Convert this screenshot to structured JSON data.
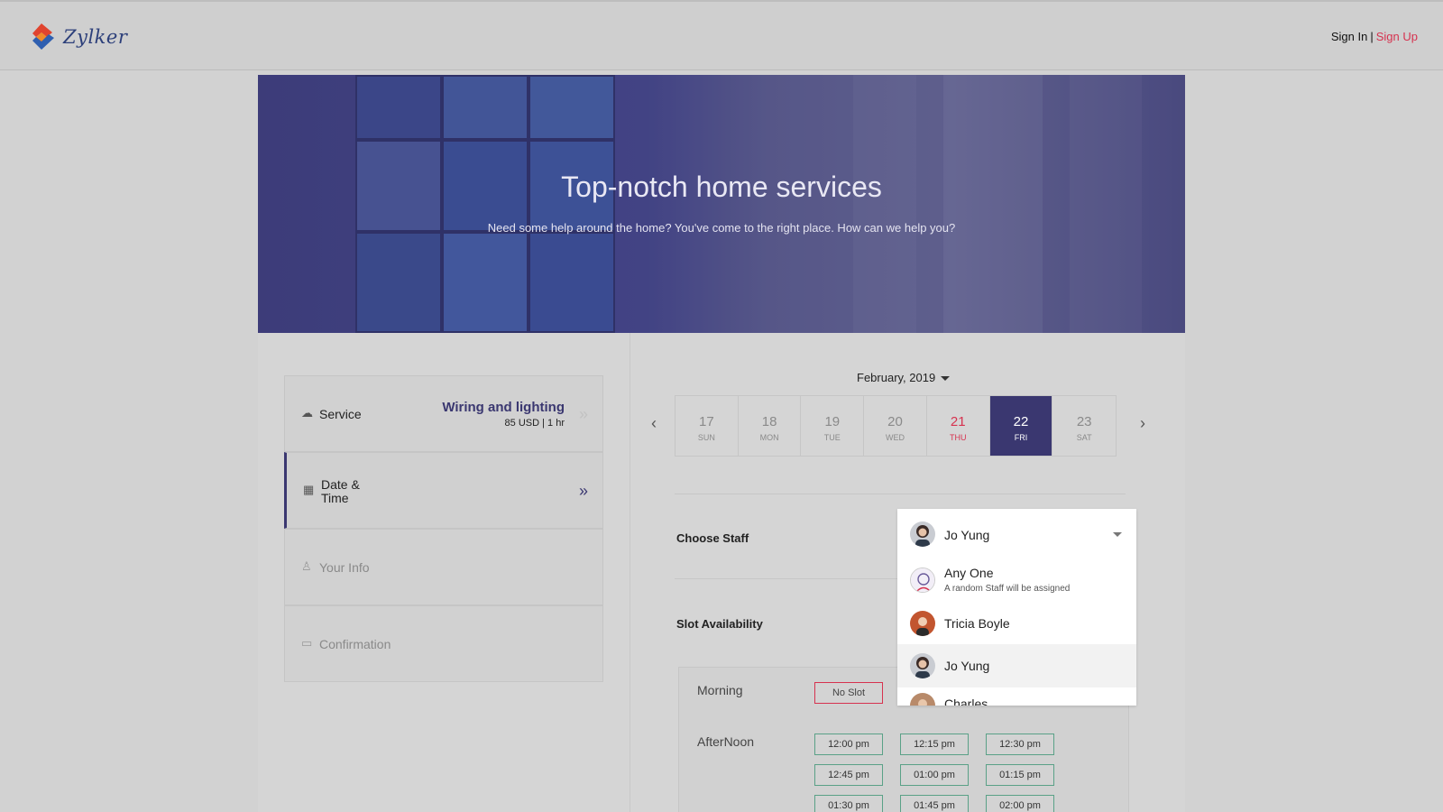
{
  "brand": {
    "name": "Zylker"
  },
  "auth": {
    "sign_in": "Sign In",
    "separator": "|",
    "sign_up": "Sign Up"
  },
  "hero": {
    "title": "Top-notch home services",
    "subtitle": "Need some help around the home? You've come to the right place. How can we help you?"
  },
  "steps": {
    "service": {
      "label": "Service",
      "name": "Wiring and lighting",
      "meta": "85 USD | 1 hr",
      "icon": "cloud-icon"
    },
    "datetime": {
      "label_line1": "Date &",
      "label_line2": "Time",
      "icon": "calendar-icon"
    },
    "info": {
      "label": "Your Info",
      "icon": "user-icon"
    },
    "confirmation": {
      "label": "Confirmation",
      "icon": "card-icon"
    }
  },
  "calendar": {
    "month": "February, 2019",
    "days": [
      {
        "num": "17",
        "dow": "SUN",
        "state": "normal"
      },
      {
        "num": "18",
        "dow": "MON",
        "state": "normal"
      },
      {
        "num": "19",
        "dow": "TUE",
        "state": "normal"
      },
      {
        "num": "20",
        "dow": "WED",
        "state": "normal"
      },
      {
        "num": "21",
        "dow": "THU",
        "state": "today"
      },
      {
        "num": "22",
        "dow": "FRI",
        "state": "selected"
      },
      {
        "num": "23",
        "dow": "SAT",
        "state": "normal"
      }
    ],
    "prev_icon": "‹",
    "next_icon": "›"
  },
  "staff": {
    "label": "Choose Staff",
    "selected": "Jo Yung",
    "options": [
      {
        "name": "Any One",
        "note": "A random Staff will be assigned"
      },
      {
        "name": "Tricia Boyle"
      },
      {
        "name": "Jo Yung"
      },
      {
        "name": "Charles"
      }
    ]
  },
  "slots": {
    "label": "Slot Availability",
    "morning": {
      "label": "Morning",
      "none": "No Slot"
    },
    "afternoon": {
      "label": "AfterNoon",
      "times": [
        "12:00 pm",
        "12:15 pm",
        "12:30 pm",
        "12:45 pm",
        "01:00 pm",
        "01:15 pm",
        "01:30 pm",
        "01:45 pm",
        "02:00 pm"
      ]
    }
  },
  "colors": {
    "accent": "#3a3770",
    "brand_red": "#d6324f",
    "slot_green": "#5aa187"
  }
}
